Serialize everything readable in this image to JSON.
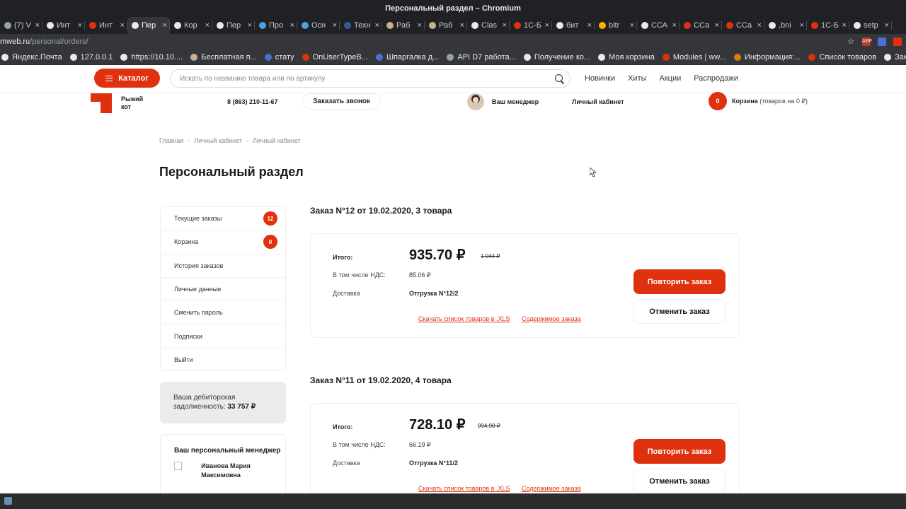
{
  "browser": {
    "title": "Персональный раздел – Chromium",
    "tabs": [
      {
        "label": "(7) V",
        "color": "#9aa0a6"
      },
      {
        "label": "Инт",
        "color": "#e8eaed"
      },
      {
        "label": "Инт",
        "color": "#e0310f"
      },
      {
        "label": "Пер",
        "color": "#e8eaed",
        "active": true
      },
      {
        "label": "Кор",
        "color": "#e8eaed"
      },
      {
        "label": "Пер",
        "color": "#e8eaed"
      },
      {
        "label": "Про",
        "color": "#4aa3df"
      },
      {
        "label": "Осн",
        "color": "#4aa3df"
      },
      {
        "label": "Техн",
        "color": "#3b5998"
      },
      {
        "label": "Раб",
        "color": "#c8b08a"
      },
      {
        "label": "Раб",
        "color": "#c8b08a"
      },
      {
        "label": "Clas",
        "color": "#e8eaed"
      },
      {
        "label": "1С-Б",
        "color": "#e0310f"
      },
      {
        "label": "бит",
        "color": "#e8eaed"
      },
      {
        "label": "bitr",
        "color": "#f4b400"
      },
      {
        "label": "ССА",
        "color": "#e8eaed"
      },
      {
        "label": "ССа",
        "color": "#e0310f"
      },
      {
        "label": "ССа",
        "color": "#e0310f"
      },
      {
        "label": ",bni",
        "color": "#e8eaed"
      },
      {
        "label": "1С-Б",
        "color": "#e0310f"
      },
      {
        "label": "setp",
        "color": "#e8eaed"
      }
    ],
    "url_prefix": "mweb.ru",
    "url_path": "/personal/orders/",
    "bookmarks": [
      {
        "label": "Яндекс.Почта",
        "color": "#e8eaed"
      },
      {
        "label": "127.0.0.1",
        "color": "#e8eaed"
      },
      {
        "label": "https://10.10....",
        "color": "#e8eaed"
      },
      {
        "label": "Бесплатная п...",
        "color": "#c8b08a"
      },
      {
        "label": "стату",
        "color": "#4a6fd8"
      },
      {
        "label": "OnUserTypeB...",
        "color": "#e0310f"
      },
      {
        "label": "Шпаргалка д...",
        "color": "#4a6fd8"
      },
      {
        "label": "API D7 работа...",
        "color": "#9aa0a6"
      },
      {
        "label": "Получение ко...",
        "color": "#e8eaed"
      },
      {
        "label": "Моя корзина",
        "color": "#e8eaed"
      },
      {
        "label": "Modules | ww...",
        "color": "#e0310f"
      },
      {
        "label": "Информация:...",
        "color": "#e07a10"
      },
      {
        "label": "Список товаров",
        "color": "#e0310f"
      },
      {
        "label": "Закрыть",
        "color": "#e8eaed"
      }
    ]
  },
  "header": {
    "catalog": "Каталог",
    "search_placeholder": "Искать по названию товара или по артикулу",
    "nav": [
      "Новинки",
      "Хиты",
      "Акции",
      "Распродажи"
    ],
    "logo_line1": "Рыжий",
    "logo_line2": "кот",
    "phone": "8 (863) 210-11-67",
    "callback": "Заказать звонок",
    "manager": "Ваш менеджер",
    "cabinet": "Личный кабинет",
    "cart_count": "0",
    "cart_label": "Корзина",
    "cart_info": "(товаров на 0 ₽)",
    "accent": "#e0310f"
  },
  "breadcrumb": [
    "Главная",
    "Личный кабинет",
    "Личный кабинет"
  ],
  "breadcrumb_sep": "-",
  "page_title": "Персональный раздел",
  "sidebar": {
    "items": [
      {
        "label": "Текущие заказы",
        "badge": "12"
      },
      {
        "label": "Корзина",
        "badge": "0"
      },
      {
        "label": "История заказов"
      },
      {
        "label": "Личные данные"
      },
      {
        "label": "Сменить пароль"
      },
      {
        "label": "Подписки"
      },
      {
        "label": "Выйти"
      }
    ],
    "debt_label": "Ваша дебиторская задолженность:",
    "debt_value": "33 757 ₽",
    "manager_title": "Ваш персональный менеджер",
    "manager_name": "Иванова Мария Максимовна"
  },
  "orders": [
    {
      "title": "Заказ N°12 от 19.02.2020, 3 товара",
      "total_label": "Итого:",
      "total": "935.70 ₽",
      "old_total": "1 044 ₽",
      "vat_label": "В том числе НДС:",
      "vat": "85.06 ₽",
      "delivery_label": "Доставка",
      "delivery": "Отгрузка N°12/2",
      "download_link": "Скачать список товаров в .XLS",
      "contents_link": "Содержимое заказа",
      "repeat": "Повторить заказ",
      "cancel": "Отменить заказ"
    },
    {
      "title": "Заказ N°11 от 19.02.2020, 4 товара",
      "total_label": "Итого:",
      "total": "728.10 ₽",
      "old_total": "994.90 ₽",
      "vat_label": "В том числе НДС:",
      "vat": "66.19 ₽",
      "delivery_label": "Доставка",
      "delivery": "Отгрузка N°11/2",
      "download_link": "Скачать список товаров в .XLS",
      "contents_link": "Содержимое заказа",
      "repeat": "Повторить заказ",
      "cancel": "Отменить заказ"
    }
  ]
}
